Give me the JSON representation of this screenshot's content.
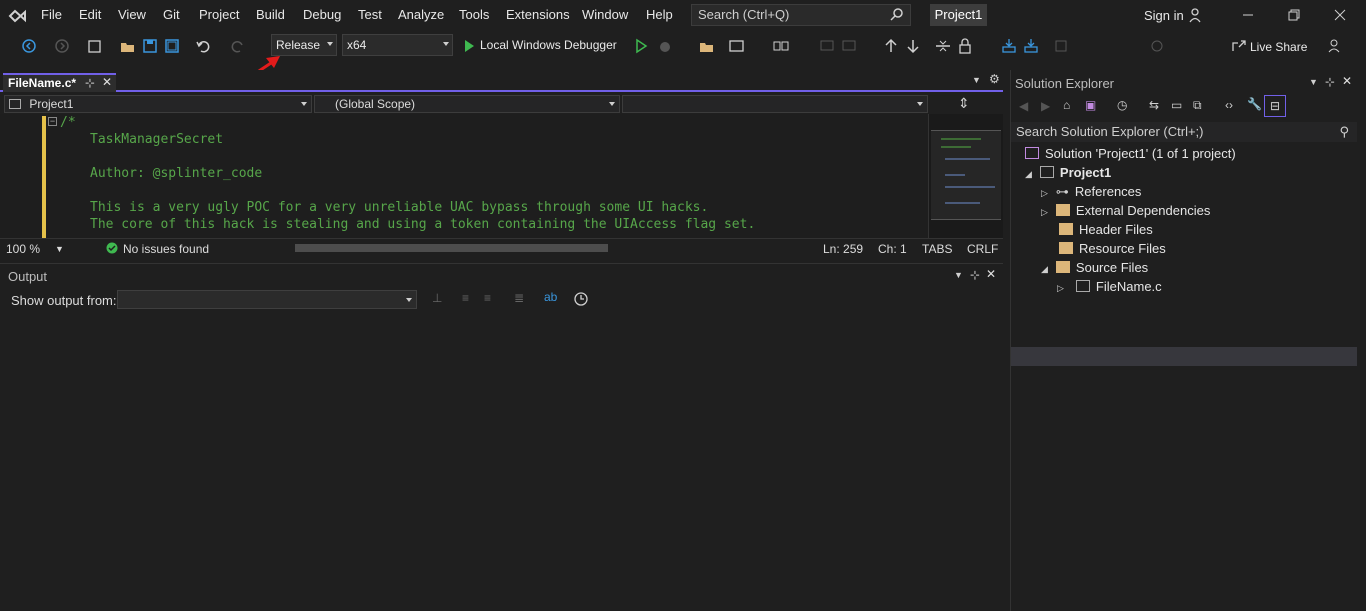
{
  "menu": {
    "items": [
      "File",
      "Edit",
      "View",
      "Git",
      "Project",
      "Build",
      "Debug",
      "Test",
      "Analyze",
      "Tools",
      "Extensions",
      "Window",
      "Help"
    ],
    "search_placeholder": "Search (Ctrl+Q)",
    "project_name": "Project1",
    "signin": "Sign in"
  },
  "toolbar": {
    "configuration": "Release",
    "platform": "x64",
    "debugger": "Local Windows Debugger",
    "live_share": "Live Share"
  },
  "editor": {
    "tab_label": "FileName.c*",
    "nav_project": "Project1",
    "nav_scope": "(Global Scope)",
    "nav_member": "",
    "code_lines": [
      "/*",
      "TaskManagerSecret",
      "",
      "Author: @splinter_code",
      "",
      "This is a very ugly POC for a very unreliable UAC bypass through some UI hacks.",
      "The core of this hack is stealing and using a token containing the UIAccess flag set."
    ]
  },
  "status": {
    "zoom": "100 %",
    "issues": "No issues found",
    "line": "Ln: 259",
    "col": "Ch: 1",
    "tabs": "TABS",
    "eol": "CRLF"
  },
  "output": {
    "title": "Output",
    "show_from_label": "Show output from:",
    "source_value": ""
  },
  "solution_explorer": {
    "title": "Solution Explorer",
    "search_placeholder": "Search Solution Explorer (Ctrl+;)",
    "tree": [
      {
        "label": "Solution 'Project1' (1 of 1 project)",
        "level": 0
      },
      {
        "label": "Project1",
        "level": 1,
        "bold": true
      },
      {
        "label": "References",
        "level": 2
      },
      {
        "label": "External Dependencies",
        "level": 2
      },
      {
        "label": "Header Files",
        "level": 2
      },
      {
        "label": "Resource Files",
        "level": 2
      },
      {
        "label": "Source Files",
        "level": 2
      },
      {
        "label": "FileName.c",
        "level": 3
      }
    ]
  },
  "colors": {
    "accent": "#7160e8",
    "comment_green": "#57a64a",
    "annotation_red": "#e21b1b"
  }
}
